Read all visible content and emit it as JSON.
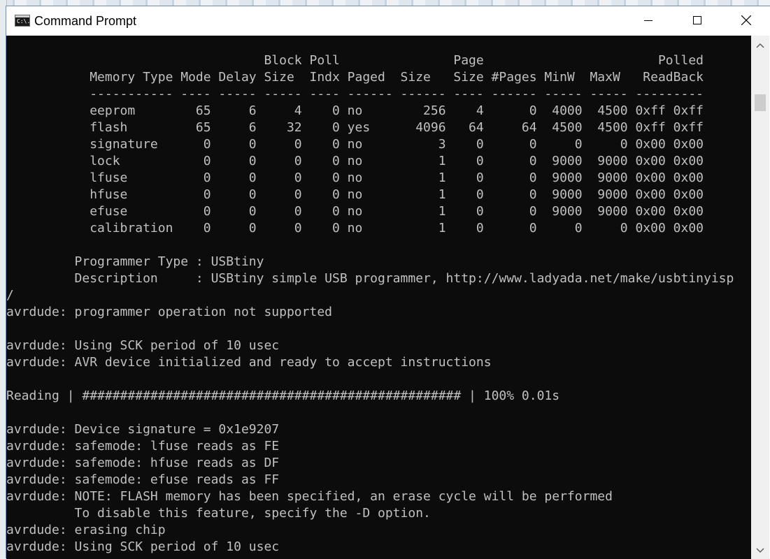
{
  "window": {
    "title": "Command Prompt",
    "icon_text": "C:\\."
  },
  "console": {
    "lines": [
      "                                  Block Poll               Page                       Polled",
      "           Memory Type Mode Delay Size  Indx Paged  Size   Size #Pages MinW  MaxW   ReadBack",
      "           ----------- ---- ----- ----- ---- ------ ------ ---- ------ ----- ----- ---------",
      "           eeprom        65     6     4    0 no        256    4      0  4000  4500 0xff 0xff",
      "           flash         65     6    32    0 yes      4096   64     64  4500  4500 0xff 0xff",
      "           signature      0     0     0    0 no          3    0      0     0     0 0x00 0x00",
      "           lock           0     0     0    0 no          1    0      0  9000  9000 0x00 0x00",
      "           lfuse          0     0     0    0 no          1    0      0  9000  9000 0x00 0x00",
      "           hfuse          0     0     0    0 no          1    0      0  9000  9000 0x00 0x00",
      "           efuse          0     0     0    0 no          1    0      0  9000  9000 0x00 0x00",
      "           calibration    0     0     0    0 no          1    0      0     0     0 0x00 0x00",
      "",
      "         Programmer Type : USBtiny",
      "         Description     : USBtiny simple USB programmer, http://www.ladyada.net/make/usbtinyisp",
      "/",
      "avrdude: programmer operation not supported",
      "",
      "avrdude: Using SCK period of 10 usec",
      "avrdude: AVR device initialized and ready to accept instructions",
      "",
      "Reading | ################################################## | 100% 0.01s",
      "",
      "avrdude: Device signature = 0x1e9207",
      "avrdude: safemode: lfuse reads as FE",
      "avrdude: safemode: hfuse reads as DF",
      "avrdude: safemode: efuse reads as FF",
      "avrdude: NOTE: FLASH memory has been specified, an erase cycle will be performed",
      "         To disable this feature, specify the -D option.",
      "avrdude: erasing chip",
      "avrdude: Using SCK period of 10 usec"
    ]
  },
  "colors": {
    "console_bg": "#0c0c0c",
    "console_text": "#c0c0c0"
  }
}
